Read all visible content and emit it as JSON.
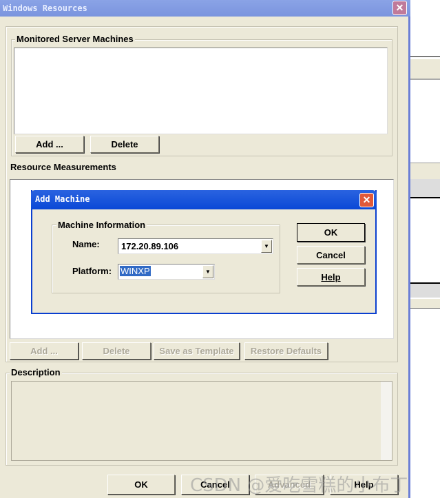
{
  "window": {
    "title": "Windows Resources",
    "close": "✕"
  },
  "monitored": {
    "label": "Monitored Server Machines",
    "add": "Add ...",
    "delete": "Delete"
  },
  "resources": {
    "label": "Resource Measurements",
    "add": "Add ...",
    "delete": "Delete",
    "save_template": "Save as Template",
    "restore": "Restore Defaults"
  },
  "description": {
    "label": "Description"
  },
  "footer": {
    "ok": "OK",
    "cancel": "Cancel",
    "advanced": "Advanced",
    "help": "Help"
  },
  "dialog": {
    "title": "Add Machine",
    "close": "✕",
    "group": "Machine Information",
    "name_label": "Name:",
    "name_value": "172.20.89.106",
    "platform_label": "Platform:",
    "platform_value": "WINXP",
    "ok": "OK",
    "cancel": "Cancel",
    "help": "Help"
  },
  "watermark": "CSDN @爱吃雪糕的小布丁"
}
